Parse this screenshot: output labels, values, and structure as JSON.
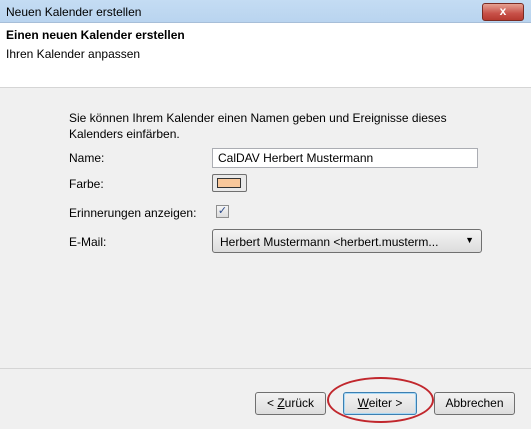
{
  "window": {
    "title": "Neuen Kalender erstellen",
    "close_label": "x"
  },
  "header": {
    "title": "Einen neuen Kalender erstellen",
    "subtitle": "Ihren Kalender anpassen"
  },
  "form": {
    "description": "Sie können Ihrem Kalender einen Namen geben und Ereignisse dieses Kalenders einfärben.",
    "name_label": "Name:",
    "name_value": "CalDAV Herbert Mustermann",
    "color_label": "Farbe:",
    "color_value": "#f9c89b",
    "reminders_label": "Erinnerungen anzeigen:",
    "reminders_checked": true,
    "reminders_checkmark": "✓",
    "email_label": "E-Mail:",
    "email_value": "Herbert Mustermann <herbert.musterm...",
    "email_arrow": "▼"
  },
  "buttons": {
    "back_prefix": "< ",
    "back_accel": "Z",
    "back_rest": "urück",
    "next_accel": "W",
    "next_rest": "eiter >",
    "cancel": "Abbrechen"
  },
  "colors": {
    "highlight": "#c1272d",
    "titlebar": "#c4dcf3"
  }
}
